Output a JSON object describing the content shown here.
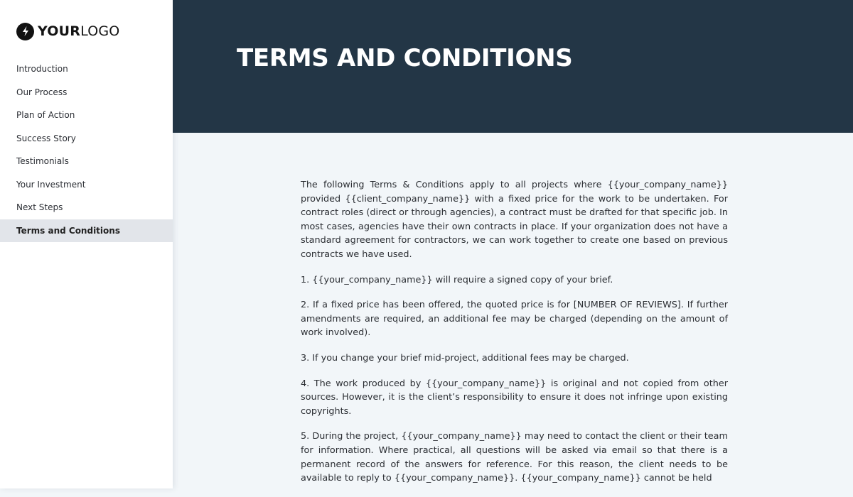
{
  "logo": {
    "bold": "YOUR",
    "light": "LOGO",
    "icon": "lightning-bolt-icon"
  },
  "sidebar": {
    "items": [
      {
        "label": "Introduction",
        "active": false
      },
      {
        "label": "Our Process",
        "active": false
      },
      {
        "label": "Plan of Action",
        "active": false
      },
      {
        "label": "Success Story",
        "active": false
      },
      {
        "label": "Testimonials",
        "active": false
      },
      {
        "label": "Your Investment",
        "active": false
      },
      {
        "label": "Next Steps",
        "active": false
      },
      {
        "label": "Terms and Conditions",
        "active": true
      }
    ]
  },
  "header": {
    "title": "TERMS AND CONDITIONS"
  },
  "content": {
    "paragraphs": [
      "The following Terms & Conditions apply to all projects where {{your_company_name}} provided {{client_company_name}}  with a fixed price for the work to be undertaken. For contract roles (direct or through agencies), a contract must be drafted for that specific job. In most cases, agencies have their own contracts in place. If your organization does not have a standard agreement for contractors, we can work together to create one based on previous contracts we have used.",
      "1. {{your_company_name}} will require a signed copy of your brief.",
      "2. If a fixed price has been offered, the quoted price is for [NUMBER OF REVIEWS]. If further amendments are required, an additional fee may be charged (depending on the amount of work involved).",
      "3. If you change your brief mid-project, additional fees may be charged.",
      "4. The work produced by {{your_company_name}} is original and not copied from other sources. However, it is the client’s responsibility to ensure it does not infringe upon existing copyrights.",
      "5. During the project, {{your_company_name}} may need to contact the client or their team for information. Where practical, all questions will be asked via email so that there is a permanent record of the answers for reference. For this reason, the client needs to be available to reply to {{your_company_name}}. {{your_company_name}} cannot be held"
    ]
  }
}
